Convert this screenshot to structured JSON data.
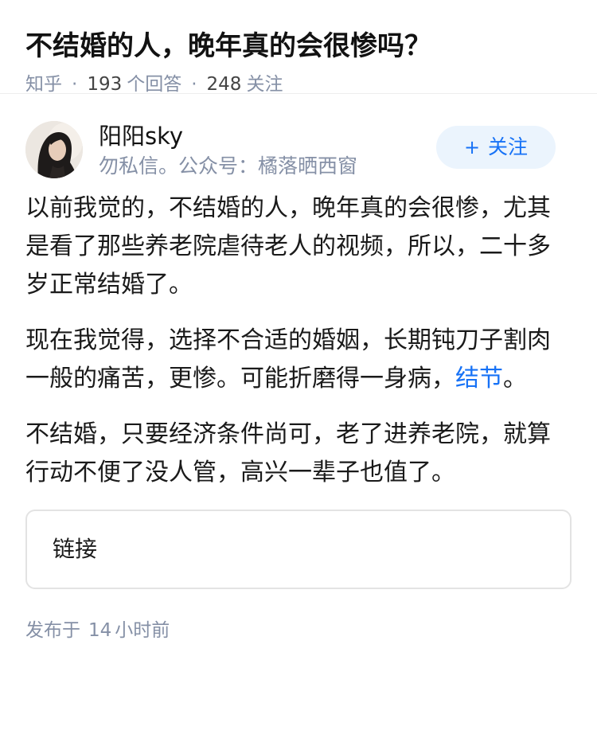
{
  "question": {
    "title": "不结婚的人，晚年真的会很惨吗？",
    "source": "知乎",
    "answer_count": "193",
    "answer_label": "个回答",
    "follow_count": "248",
    "follow_label": "关注"
  },
  "author": {
    "name": "阳阳sky",
    "bio": "勿私信。公众号：橘落晒西窗",
    "follow_button": "关注",
    "follow_icon": "plus-icon"
  },
  "answer": {
    "p1": "以前我觉的，不结婚的人，晚年真的会很惨，尤其是看了那些养老院虐待老人的视频，所以，二十多岁正常结婚了。",
    "p2_text": "现在我觉得，选择不合适的婚姻，长期钝刀子割肉一般的痛苦，更惨。可能折磨得一身病，",
    "p2_link": "结节",
    "p2_end": "。",
    "p3": "不结婚，只要经济条件尚可，老了进养老院，就算行动不便了没人管，高兴一辈子也值了。"
  },
  "link_card": {
    "label": "链接"
  },
  "publish": {
    "prefix": "发布于",
    "num": "14",
    "unit": "小时前"
  },
  "colors": {
    "accent": "#1772f6",
    "meta": "#8590a6",
    "follow_bg": "#ebf4fd"
  }
}
